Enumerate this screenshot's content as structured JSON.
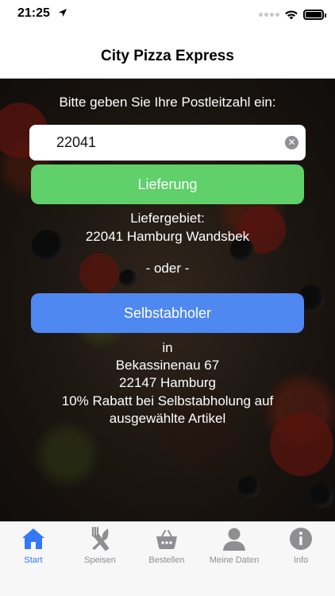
{
  "status_bar": {
    "time": "21:25"
  },
  "nav": {
    "title": "City Pizza Express"
  },
  "main": {
    "prompt": "Bitte geben Sie Ihre Postleitzahl ein:",
    "zip_input": {
      "value": "22041"
    },
    "delivery_button_label": "Lieferung",
    "delivery_area_label": "Liefergebiet:",
    "delivery_area_value": "22041 Hamburg Wandsbek",
    "separator": "- oder -",
    "pickup_button_label": "Selbstabholer",
    "pickup_in": "in",
    "pickup_street": "Bekassinenau 67",
    "pickup_city": "22147 Hamburg",
    "discount_line1": "10% Rabatt bei Selbstabholung auf",
    "discount_line2": "ausgewählte Artikel"
  },
  "tab_bar": {
    "tabs": [
      {
        "label": "Start",
        "icon": "home-icon",
        "active": true
      },
      {
        "label": "Speisen",
        "icon": "fork-knife-icon",
        "active": false
      },
      {
        "label": "Bestellen",
        "icon": "basket-icon",
        "active": false
      },
      {
        "label": "Meine Daten",
        "icon": "person-icon",
        "active": false
      },
      {
        "label": "Info",
        "icon": "info-icon",
        "active": false
      }
    ]
  },
  "colors": {
    "delivery_button": "#5fd06a",
    "pickup_button": "#4f88f0",
    "tab_active": "#3478f6",
    "tab_inactive": "#8e8e93"
  }
}
